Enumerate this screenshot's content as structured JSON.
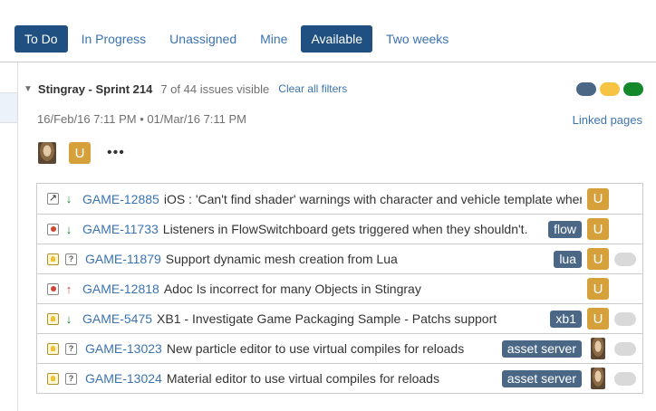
{
  "quick_filters": [
    {
      "label": "To Do",
      "active": true
    },
    {
      "label": "In Progress",
      "active": false
    },
    {
      "label": "Unassigned",
      "active": false
    },
    {
      "label": "Mine",
      "active": false
    },
    {
      "label": "Available",
      "active": true
    },
    {
      "label": "Two weeks",
      "active": false
    }
  ],
  "sprint": {
    "name": "Stingray - Sprint 214",
    "visible_count": "7 of 44 issues visible",
    "clear_filters": "Clear all filters",
    "start": "16/Feb/16 7:11 PM",
    "separator": "•",
    "end": "01/Mar/16 7:11 PM",
    "linked_pages": "Linked pages",
    "status_colors": [
      "#4a6785",
      "#f6c342",
      "#14892c"
    ],
    "more": "•••",
    "assignee_avatar_letter": "U"
  },
  "issues": [
    {
      "type": "story",
      "priority": "low",
      "key": "GAME-12885",
      "summary": "iOS : 'Can't find shader' warnings with character and vehicle template when",
      "label": "",
      "assignee": "U",
      "toggle": false
    },
    {
      "type": "bug",
      "priority": "low",
      "key": "GAME-11733",
      "summary": "Listeners in FlowSwitchboard gets triggered when they shouldn't.",
      "label": "flow",
      "assignee": "U",
      "toggle": false
    },
    {
      "type": "idea",
      "priority": "unknown",
      "key": "GAME-11879",
      "summary": "Support dynamic mesh creation from Lua",
      "label": "lua",
      "assignee": "U",
      "toggle": true
    },
    {
      "type": "bug",
      "priority": "high",
      "key": "GAME-12818",
      "summary": "Adoc Is incorrect for many Objects in Stingray",
      "label": "",
      "assignee": "U",
      "toggle": false
    },
    {
      "type": "idea",
      "priority": "low",
      "key": "GAME-5475",
      "summary": "XB1 - Investigate Game Packaging Sample - Patchs support",
      "label": "xb1",
      "assignee": "U",
      "toggle": true
    },
    {
      "type": "idea",
      "priority": "unknown",
      "key": "GAME-13023",
      "summary": "New particle editor to use virtual compiles for reloads",
      "label": "asset server",
      "assignee": "photo",
      "toggle": true
    },
    {
      "type": "idea",
      "priority": "unknown",
      "key": "GAME-13024",
      "summary": "Material editor to use virtual compiles for reloads",
      "label": "asset server",
      "assignee": "photo",
      "toggle": true
    }
  ],
  "icons": {
    "story": "story-type-icon",
    "bug": "bug-type-icon",
    "idea": "improvement-type-icon",
    "low": "priority-low-icon",
    "high": "priority-high-icon",
    "unknown": "priority-unknown-icon"
  }
}
